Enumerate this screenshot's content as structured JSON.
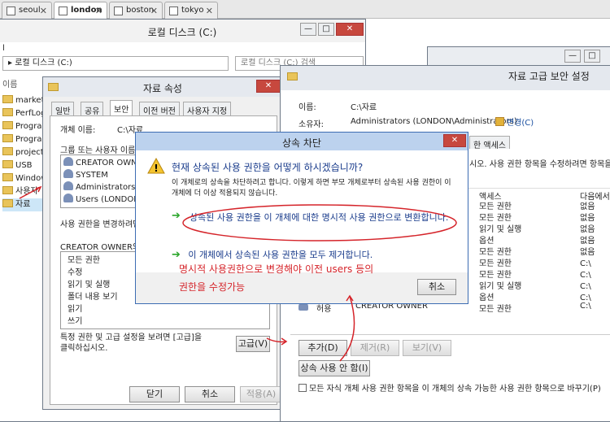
{
  "browser_tabs": [
    "seoul",
    "london",
    "boston",
    "tokyo"
  ],
  "explorer": {
    "title": "로컬 디스크 (C:)",
    "path": "로컬 디스크 (C:)",
    "search_placeholder": "로컬 디스크 (C:) 검색",
    "name_header": "이름",
    "folders": [
      "marketing",
      "PerfLogs",
      "Program",
      "Program",
      "project",
      "USB",
      "Windows",
      "사용자",
      "자료"
    ]
  },
  "props": {
    "title": "자료 속성",
    "tabs": [
      "일반",
      "공유",
      "보안",
      "이전 버전",
      "사용자 지정"
    ],
    "object_label": "개체 이름:",
    "object_value": "C:\\자료",
    "group_label": "그룹 또는 사용자 이름(",
    "users": [
      "CREATOR OWNER",
      "SYSTEM",
      "Administrators (LON",
      "Users (LONDON\\Us"
    ],
    "change_text": "사용 권한을 변경하려면",
    "perm_label": "CREATOR OWNER의 사",
    "perms": [
      "모든 권한",
      "수정",
      "읽기 및 실행",
      "폴더 내용 보기",
      "읽기",
      "쓰기"
    ],
    "footer_text": "특정 권한 및 고급 설정을 보려면 [고급]을 클릭하십시오.",
    "advanced_btn": "고급(V)",
    "ok_btn": "닫기",
    "cancel_btn": "취소",
    "apply_btn": "적용(A)"
  },
  "adv": {
    "title": "자료 고급 보안 설정",
    "name_label": "이름:",
    "name_value": "C:\\자료",
    "owner_label": "소유자:",
    "owner_value": "Administrators (LONDON\\Administrators)",
    "change_link": "변경(C)",
    "audit_tab": "한 액세스",
    "desc": "시오. 사용 권한 항목을 수정하려면 항목을 선",
    "col_access": "액세스",
    "col_inherit": "다음에서",
    "rows": [
      {
        "access": "모든 권한",
        "from": "없음"
      },
      {
        "access": "모든 권한",
        "from": "없음"
      },
      {
        "access": "읽기 및 실행",
        "from": "없음"
      },
      {
        "access": "옵션",
        "from": "없음"
      },
      {
        "access": "모든 권한",
        "from": "없음"
      },
      {
        "access": "모든 권한",
        "from": "C:\\"
      },
      {
        "access": "모든 권한",
        "from": "C:\\"
      },
      {
        "access": "읽기 및 실행",
        "from": "C:\\"
      },
      {
        "access": "옵션",
        "from": "C:\\"
      }
    ],
    "last_row": {
      "type": "허용",
      "principal": "CREATOR OWNER",
      "access": "모든 권한",
      "from": "C:\\"
    },
    "add_btn": "추가(D)",
    "remove_btn": "제거(R)",
    "view_btn": "보기(V)",
    "disable_btn": "상속 사용 안 함(I)",
    "replace_check": "모든 자식 개체 사용 권한 항목을 이 개체의 상속 가능한 사용 권한 항목으로 바꾸기(P)"
  },
  "modal": {
    "title": "상속 차단",
    "question": "현재 상속된 사용 권한을 어떻게 하시겠습니까?",
    "desc": "이 개체로의 상속을 차단하려고 합니다. 이렇게 하면 부모 개체로부터 상속된 사용 권한이 이 개체에 더 이상 적용되지 않습니다.",
    "opt1": "상속된 사용 권한을 이 개체에 대한 명시적 사용 권한으로 변환합니다.",
    "opt2": "이 개체에서 상속된 사용 권한을 모두 제거합니다.",
    "note_line1": "명시적 사용권한으로 변경해야 이전 users 등의",
    "note_line2": "권한을 수정가능",
    "cancel_btn": "취소"
  }
}
